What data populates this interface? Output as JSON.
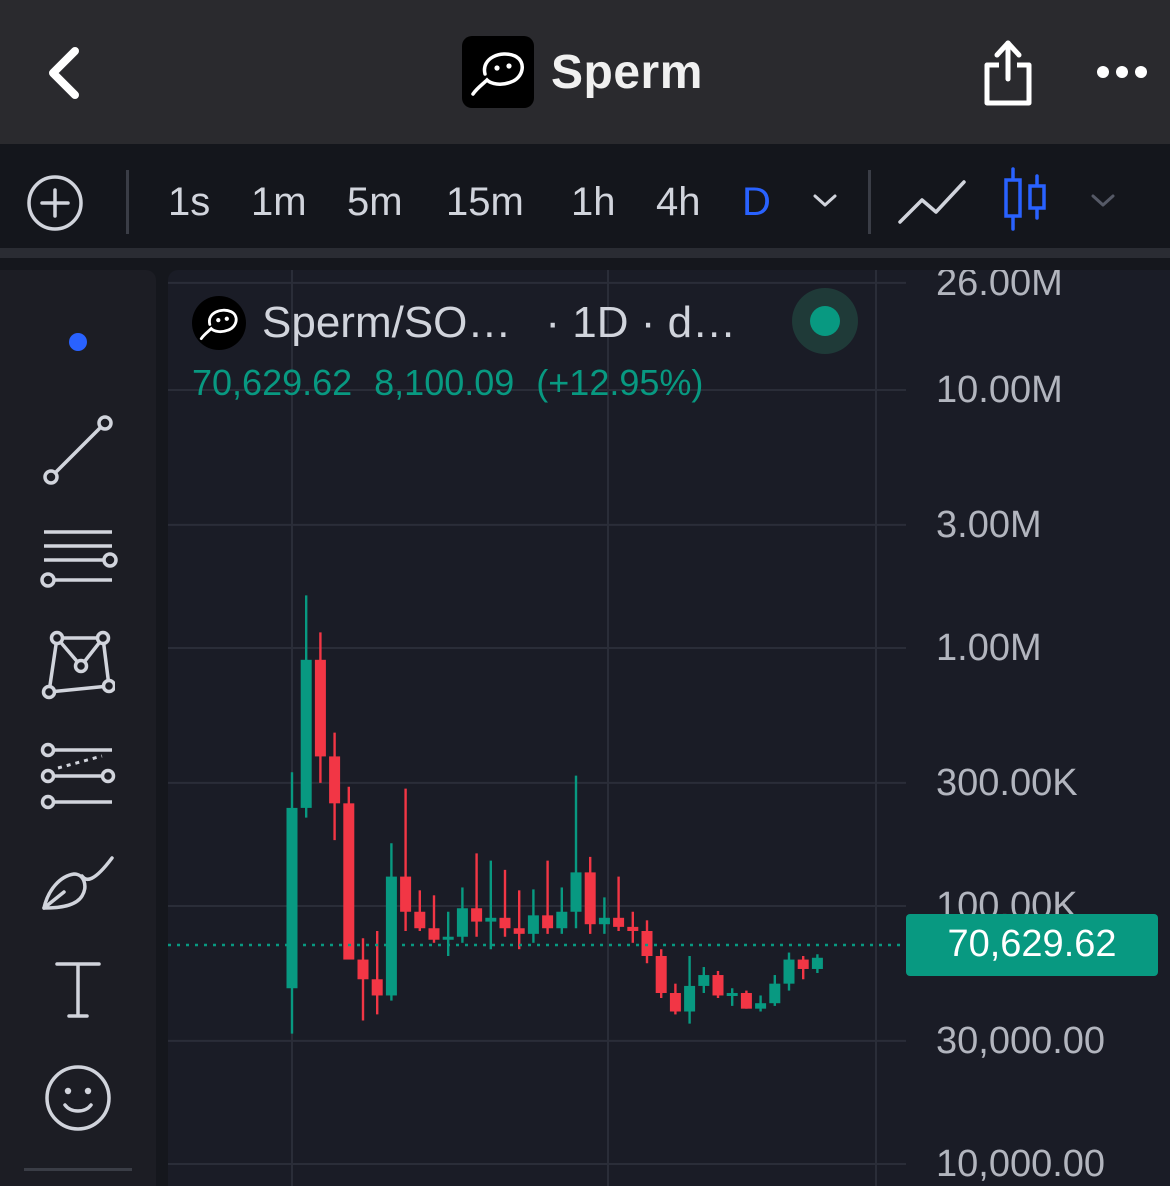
{
  "header": {
    "title": "Sperm",
    "back_icon": "chevron-left-icon",
    "share_icon": "share-icon",
    "more_icon": "more-horizontal-icon"
  },
  "toolbar": {
    "add_icon": "plus-circle-icon",
    "intervals": [
      "1s",
      "1m",
      "5m",
      "15m",
      "1h",
      "4h",
      "D"
    ],
    "active_interval": "D",
    "line_chart_icon": "line-chart-icon",
    "candle_chart_icon": "candlestick-icon"
  },
  "sidebar": {
    "tools": [
      "cursor-dot-icon",
      "trend-line-icon",
      "horizontal-lines-icon",
      "pattern-icon",
      "fib-retracement-icon",
      "brush-icon",
      "text-tool-icon",
      "emoji-icon"
    ]
  },
  "legend": {
    "symbol": "Sperm/SO…",
    "meta": "· 1D · d…",
    "last": "70,629.62",
    "change": "8,100.09",
    "change_pct": "(+12.95%)"
  },
  "price_tag": "70,629.62",
  "colors": {
    "up": "#089981",
    "down": "#f23645",
    "accent": "#2962ff"
  },
  "chart_data": {
    "type": "candlestick",
    "scale": "log",
    "grid": true,
    "y_ticks": [
      "26.00M",
      "10.00M",
      "3.00M",
      "1.00M",
      "300.00K",
      "100.00K",
      "30,000.00",
      "10,000.00"
    ],
    "y_tick_values": [
      26000000,
      10000000,
      3000000,
      1000000,
      300000,
      100000,
      30000,
      10000
    ],
    "last_price": 70629.62,
    "candles": [
      {
        "o": 48000,
        "h": 330000,
        "l": 32000,
        "c": 240000
      },
      {
        "o": 240000,
        "h": 1600000,
        "l": 220000,
        "c": 900000
      },
      {
        "o": 900000,
        "h": 1150000,
        "l": 300000,
        "c": 380000
      },
      {
        "o": 380000,
        "h": 470000,
        "l": 180000,
        "c": 250000
      },
      {
        "o": 250000,
        "h": 290000,
        "l": 90000,
        "c": 62000
      },
      {
        "o": 62000,
        "h": 75000,
        "l": 36000,
        "c": 52000
      },
      {
        "o": 52000,
        "h": 80000,
        "l": 38000,
        "c": 45000
      },
      {
        "o": 45000,
        "h": 175000,
        "l": 43000,
        "c": 130000
      },
      {
        "o": 130000,
        "h": 285000,
        "l": 80000,
        "c": 95000
      },
      {
        "o": 95000,
        "h": 115000,
        "l": 80000,
        "c": 82000
      },
      {
        "o": 82000,
        "h": 110000,
        "l": 72000,
        "c": 74000
      },
      {
        "o": 74000,
        "h": 95000,
        "l": 64000,
        "c": 76000
      },
      {
        "o": 76000,
        "h": 118000,
        "l": 72000,
        "c": 98000
      },
      {
        "o": 98000,
        "h": 160000,
        "l": 76000,
        "c": 87000
      },
      {
        "o": 87000,
        "h": 150000,
        "l": 68000,
        "c": 90000
      },
      {
        "o": 90000,
        "h": 138000,
        "l": 76000,
        "c": 82000
      },
      {
        "o": 82000,
        "h": 115000,
        "l": 68000,
        "c": 78000
      },
      {
        "o": 78000,
        "h": 116000,
        "l": 72000,
        "c": 92000
      },
      {
        "o": 92000,
        "h": 150000,
        "l": 78000,
        "c": 82000
      },
      {
        "o": 82000,
        "h": 118000,
        "l": 78000,
        "c": 95000
      },
      {
        "o": 95000,
        "h": 320000,
        "l": 82000,
        "c": 135000
      },
      {
        "o": 135000,
        "h": 155000,
        "l": 78000,
        "c": 85000
      },
      {
        "o": 85000,
        "h": 108000,
        "l": 78000,
        "c": 90000
      },
      {
        "o": 90000,
        "h": 130000,
        "l": 80000,
        "c": 83000
      },
      {
        "o": 83000,
        "h": 95000,
        "l": 72000,
        "c": 80000
      },
      {
        "o": 80000,
        "h": 88000,
        "l": 60000,
        "c": 64000
      },
      {
        "o": 64000,
        "h": 68000,
        "l": 44000,
        "c": 46000
      },
      {
        "o": 46000,
        "h": 50000,
        "l": 38000,
        "c": 39000
      },
      {
        "o": 39000,
        "h": 64000,
        "l": 35000,
        "c": 49000
      },
      {
        "o": 49000,
        "h": 58000,
        "l": 46000,
        "c": 54000
      },
      {
        "o": 54000,
        "h": 56000,
        "l": 44000,
        "c": 45000
      },
      {
        "o": 45000,
        "h": 48000,
        "l": 41000,
        "c": 46000
      },
      {
        "o": 46000,
        "h": 47000,
        "l": 40000,
        "c": 40000
      },
      {
        "o": 40000,
        "h": 45000,
        "l": 39000,
        "c": 42000
      },
      {
        "o": 42000,
        "h": 54000,
        "l": 41000,
        "c": 50000
      },
      {
        "o": 50000,
        "h": 66000,
        "l": 47000,
        "c": 62000
      },
      {
        "o": 62000,
        "h": 64000,
        "l": 52000,
        "c": 57000
      },
      {
        "o": 57000,
        "h": 65000,
        "l": 55000,
        "c": 63000
      }
    ]
  }
}
